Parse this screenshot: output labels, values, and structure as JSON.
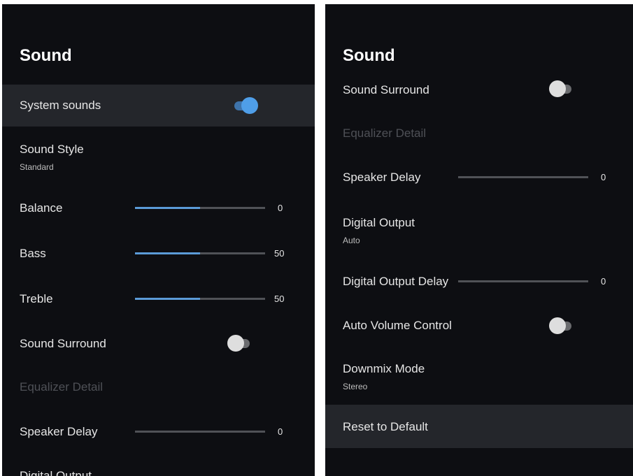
{
  "left": {
    "title": "Sound",
    "system_sounds": {
      "label": "System sounds",
      "on": true
    },
    "sound_style": {
      "label": "Sound Style",
      "value": "Standard"
    },
    "balance": {
      "label": "Balance",
      "value": "0",
      "fraction": 0.5
    },
    "bass": {
      "label": "Bass",
      "value": "50",
      "fraction": 0.5
    },
    "treble": {
      "label": "Treble",
      "value": "50",
      "fraction": 0.5
    },
    "sound_surround": {
      "label": "Sound Surround",
      "on": false
    },
    "equalizer_detail": {
      "label": "Equalizer Detail",
      "enabled": false
    },
    "speaker_delay": {
      "label": "Speaker Delay",
      "value": "0",
      "fraction": 0
    },
    "digital_output": {
      "label": "Digital Output"
    }
  },
  "right": {
    "title": "Sound",
    "sound_surround": {
      "label": "Sound Surround",
      "on": false
    },
    "equalizer_detail": {
      "label": "Equalizer Detail",
      "enabled": false
    },
    "speaker_delay": {
      "label": "Speaker Delay",
      "value": "0",
      "fraction": 0
    },
    "digital_output": {
      "label": "Digital Output",
      "value": "Auto"
    },
    "digital_output_delay": {
      "label": "Digital Output Delay",
      "value": "0",
      "fraction": 0
    },
    "auto_volume_control": {
      "label": "Auto Volume Control",
      "on": false
    },
    "downmix_mode": {
      "label": "Downmix Mode",
      "value": "Stereo"
    },
    "reset": {
      "label": "Reset to Default"
    }
  },
  "colors": {
    "background": "#0d0e12",
    "selected_row": "#24262b",
    "accent": "#5b9bd8",
    "disabled_text": "#4e5056"
  }
}
